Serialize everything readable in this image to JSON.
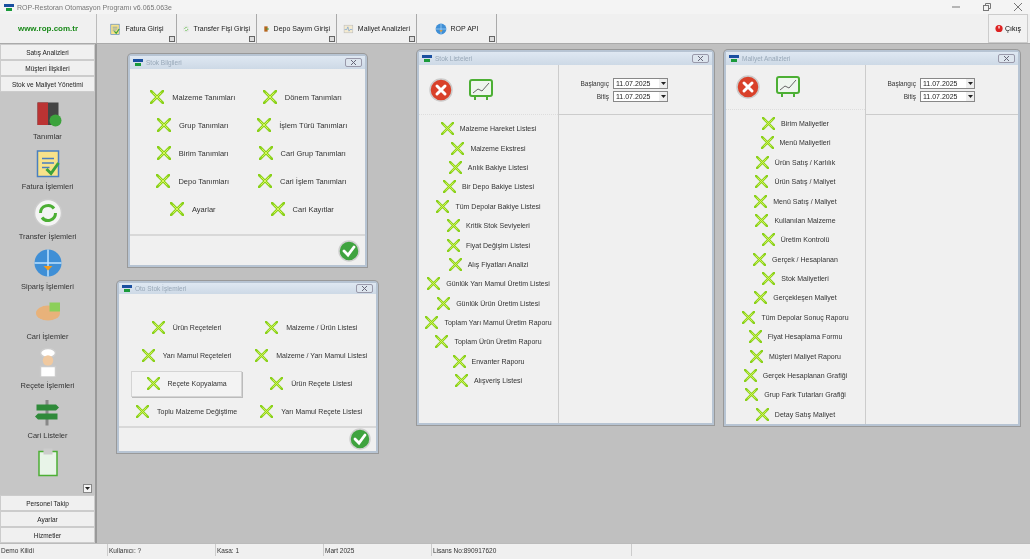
{
  "window": {
    "title": "ROP-Restoran Otomasyon Programı v6.065.063e"
  },
  "toolbar": {
    "logo": "www.rop.com.tr",
    "buttons": [
      {
        "label": "Fatura Girişi",
        "kind": "invoice"
      },
      {
        "label": "Transfer Fişi Girişi",
        "kind": "transfer"
      },
      {
        "label": "Depo Sayım Girişi",
        "kind": "door"
      },
      {
        "label": "Maliyet Analizleri",
        "kind": "chart"
      },
      {
        "label": "ROP API",
        "kind": "globe"
      }
    ],
    "exit": "Çıkış"
  },
  "sidebar": {
    "top_items": [
      "Satış Analizleri",
      "Müşteri İlişkileri",
      "Stok ve Maliyet Yönetimi"
    ],
    "modules": [
      {
        "label": "Tanımlar",
        "kind": "server"
      },
      {
        "label": "Fatura İşlemleri",
        "kind": "invoice"
      },
      {
        "label": "Transfer İşlemleri",
        "kind": "transfer"
      },
      {
        "label": "Sipariş İşlemleri",
        "kind": "globe"
      },
      {
        "label": "Cari İşlemler",
        "kind": "hands"
      },
      {
        "label": "Reçete İşlemleri",
        "kind": "chef"
      },
      {
        "label": "Cari Listeler",
        "kind": "signpost"
      },
      {
        "kind": "clipboard"
      }
    ],
    "bottom_items": [
      "Personel Takip",
      "Ayarlar",
      "Hizmetler"
    ]
  },
  "windows": [
    {
      "kind": "grid",
      "title": "Stok Bilgileri",
      "items": [
        {
          "label": "Malzeme Tanımları",
          "selected": false
        },
        {
          "label": "Dönem Tanımları",
          "selected": false
        },
        {
          "label": "Grup Tanımları",
          "selected": false
        },
        {
          "label": "İşlem Türü Tanımları",
          "selected": false
        },
        {
          "label": "Birim Tanımları",
          "selected": false
        },
        {
          "label": "Cari Grup Tanımları",
          "selected": false
        },
        {
          "label": "Depo Tanımları",
          "selected": false
        },
        {
          "label": "Cari İşlem Tanımları",
          "selected": false
        },
        {
          "label": "Ayarlar",
          "selected": false
        },
        {
          "label": "Cari Kayıtlar",
          "selected": false
        }
      ]
    },
    {
      "kind": "grid",
      "title": "Oto Stok İşlemleri",
      "items": [
        {
          "label": "Ürün Reçeteleri",
          "selected": false
        },
        {
          "label": "Malzeme / Ürün Listesi",
          "selected": false
        },
        {
          "label": "Yarı Mamul Reçeteleri",
          "selected": false
        },
        {
          "label": "Malzeme / Yarı Mamul Listesi",
          "selected": false
        },
        {
          "label": "Reçete Kopyalama",
          "selected": true
        },
        {
          "label": "Ürün Reçete Listesi",
          "selected": false
        },
        {
          "label": "Toplu Malzeme Değiştime",
          "selected": false
        },
        {
          "label": "Yarı Mamul Reçete Listesi",
          "selected": false
        }
      ]
    },
    {
      "kind": "report",
      "title": "Stok Listeleri",
      "start_label": "Başlangıç",
      "start_date": "11.07.2025",
      "end_label": "Bitiş",
      "end_date": "11.07.2025",
      "items": [
        "Malzeme Hareket Listesi",
        "Malzeme Ekstresi",
        "Anlık Bakiye Listesi",
        "Bir Depo Bakiye Listesi",
        "Tüm Depolar Bakiye Listesi",
        "Kritik Stok Seviyeleri",
        "Fiyat Değişim Listesi",
        "Alış Fiyatları Analizi",
        "Günlük Yarı Mamul Üretim Listesi",
        "Günlük Ürün Üretim Listesi",
        "Toplam Yarı Mamul Üretim Raporu",
        "Toplam Ürün Üretim Raporu",
        "Envanter Raporu",
        "Alışveriş Listesi"
      ]
    },
    {
      "kind": "report",
      "title": "Maliyet Analizleri",
      "start_label": "Başlangıç",
      "start_date": "11.07.2025",
      "end_label": "Bitiş",
      "end_date": "11.07.2025",
      "items": [
        "Birim Maliyetler",
        "Menü Maliyetleri",
        "Ürün Satış / Karlılık",
        "Ürün Satış / Maliyet",
        "Menü Satış / Maliyet",
        "Kullanılan Malzeme",
        "Üretim Kontrolü",
        "Gerçek / Hesaplanan",
        "Stok Maliyetleri",
        "Gerçekleşen Maliyet",
        "Tüm Depolar Sonuç Raporu",
        "Fiyat Hesaplama Formu",
        "Müşteri Maliyet Raporu",
        "Gerçek Hesaplanan Grafiği",
        "Grup Fark Tutarları Grafiği",
        "Detay Satış Maliyet"
      ]
    }
  ],
  "status_bar": [
    "Demo Kilidi",
    "Kullanıcı: ?",
    "Kasa: 1",
    "Mart 2025",
    "Lisans No:890917620"
  ]
}
